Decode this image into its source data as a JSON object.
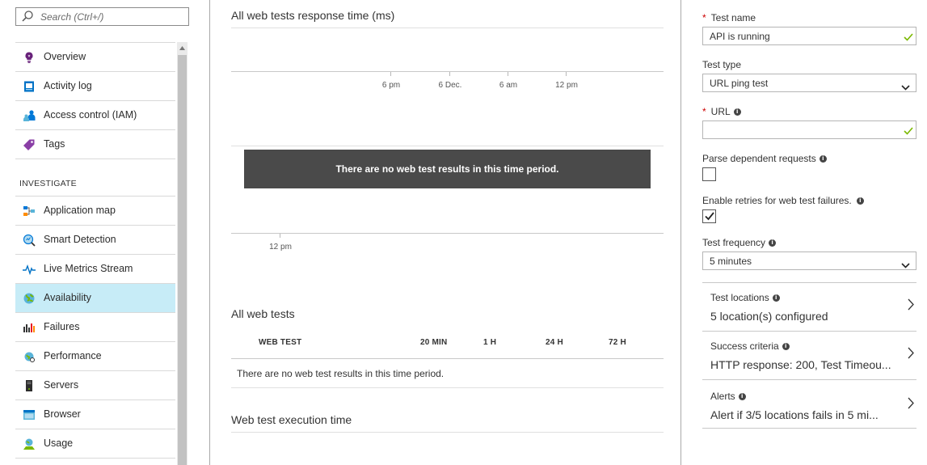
{
  "search": {
    "placeholder": "Search (Ctrl+/)"
  },
  "nav": {
    "items_top": [
      {
        "label": "Overview",
        "icon": "lightbulb-icon"
      },
      {
        "label": "Activity log",
        "icon": "log-icon"
      },
      {
        "label": "Access control (IAM)",
        "icon": "people-icon"
      },
      {
        "label": "Tags",
        "icon": "tag-icon"
      }
    ],
    "section_investigate": "INVESTIGATE",
    "items_investigate": [
      {
        "label": "Application map",
        "icon": "app-map-icon"
      },
      {
        "label": "Smart Detection",
        "icon": "smart-detection-icon"
      },
      {
        "label": "Live Metrics Stream",
        "icon": "pulse-icon"
      },
      {
        "label": "Availability",
        "icon": "globe-icon",
        "active": true
      },
      {
        "label": "Failures",
        "icon": "failures-chart-icon"
      },
      {
        "label": "Performance",
        "icon": "performance-icon"
      },
      {
        "label": "Servers",
        "icon": "server-icon"
      },
      {
        "label": "Browser",
        "icon": "browser-icon"
      },
      {
        "label": "Usage",
        "icon": "usage-icon"
      }
    ]
  },
  "main": {
    "response_chart": {
      "title": "All web tests response time (ms)",
      "tick_labels": [
        "6 pm",
        "6 Dec.",
        "6 am",
        "12 pm"
      ]
    },
    "no_results_banner": "There are no web test results in this time period.",
    "lower_chart": {
      "tick_labels": [
        "12 pm"
      ]
    },
    "all_tests": {
      "title": "All web tests",
      "columns": [
        "WEB TEST",
        "20 MIN",
        "1 H",
        "24 H",
        "72 H"
      ],
      "empty_message": "There are no web test results in this time period."
    },
    "execution_time": {
      "title": "Web test execution time"
    }
  },
  "form": {
    "test_name": {
      "label": "Test name",
      "value": "API is running",
      "required": true
    },
    "test_type": {
      "label": "Test type",
      "value": "URL ping test"
    },
    "url": {
      "label": "URL",
      "value": "",
      "required": true
    },
    "parse_dependent": {
      "label": "Parse dependent requests",
      "checked": false
    },
    "enable_retries": {
      "label": "Enable retries for web test failures.",
      "checked": true
    },
    "test_frequency": {
      "label": "Test frequency",
      "value": "5 minutes"
    },
    "test_locations": {
      "label": "Test locations",
      "value": "5 location(s) configured"
    },
    "success_criteria": {
      "label": "Success criteria",
      "value": "HTTP response: 200, Test Timeou..."
    },
    "alerts": {
      "label": "Alerts",
      "value": "Alert if 3/5 locations fails in 5 mi..."
    }
  },
  "colors": {
    "active_nav_bg": "#c7ecf7",
    "valid_check": "#7ab800",
    "required_star": "#cc0000",
    "banner_bg": "#4a4a4a"
  }
}
